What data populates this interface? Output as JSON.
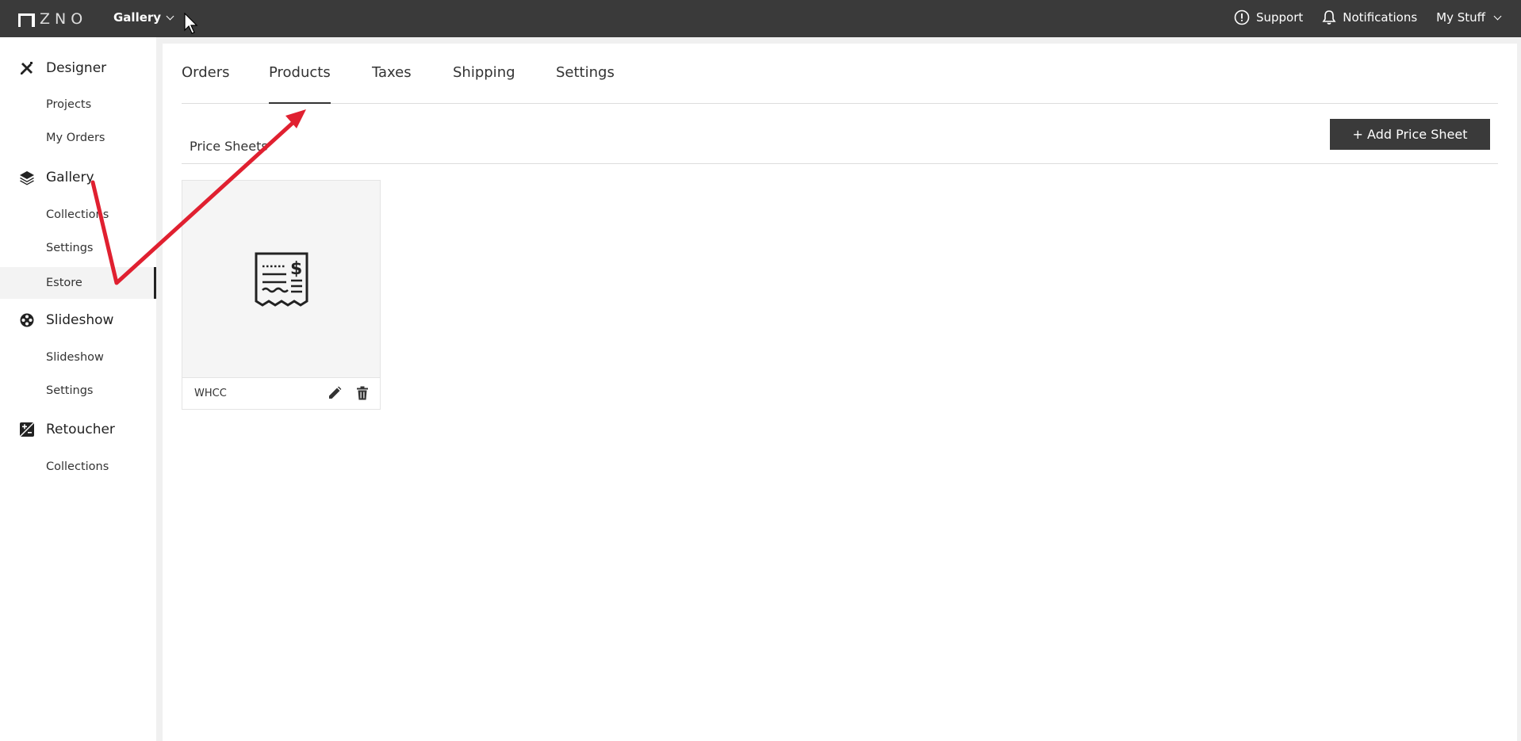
{
  "topbar": {
    "logo_text": "ZNO",
    "app_switch": "Gallery",
    "support": "Support",
    "notifications": "Notifications",
    "my_stuff": "My Stuff"
  },
  "sidebar": {
    "designer": {
      "label": "Designer",
      "icon": "pencil-ruler-icon",
      "items": [
        "Projects",
        "My Orders"
      ]
    },
    "gallery": {
      "label": "Gallery",
      "icon": "layers-icon",
      "items": [
        "Collections",
        "Settings",
        "Estore"
      ]
    },
    "slideshow": {
      "label": "Slideshow",
      "icon": "film-reel-icon",
      "items": [
        "Slideshow",
        "Settings"
      ]
    },
    "retoucher": {
      "label": "Retoucher",
      "icon": "exposure-icon",
      "items": [
        "Collections"
      ]
    },
    "active_item": "Estore"
  },
  "tabs": [
    "Orders",
    "Products",
    "Taxes",
    "Shipping",
    "Settings"
  ],
  "active_tab": "Products",
  "price_sheets": {
    "title": "Price Sheets",
    "add_label": "+ Add Price Sheet",
    "items": [
      {
        "name": "WHCC",
        "icon": "receipt-icon"
      }
    ]
  },
  "colors": {
    "topbar": "#3a3a3a",
    "annotation": "#e02030",
    "button": "#3a3a3a"
  }
}
